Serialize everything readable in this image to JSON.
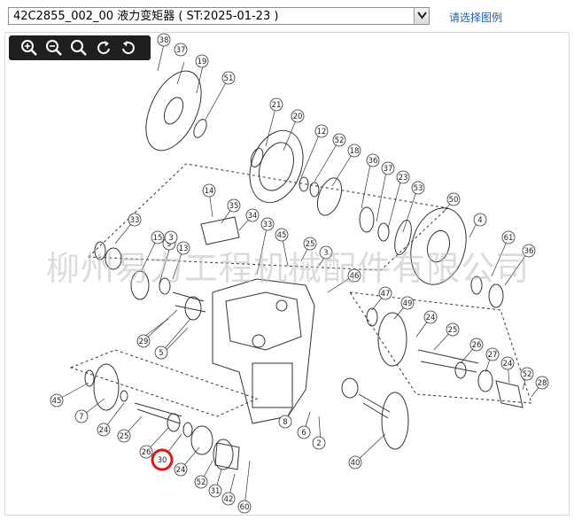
{
  "header": {
    "diagram_select_value": "42C2855_002_00 液力变矩器 ( ST:2025-01-23 )",
    "select_diagram_link": "请选择图例"
  },
  "toolbar": {
    "buttons": [
      {
        "name": "zoom-in",
        "icon": "zoom-in-icon"
      },
      {
        "name": "zoom-out",
        "icon": "zoom-out-icon"
      },
      {
        "name": "zoom-fit",
        "icon": "zoom-fit-icon"
      },
      {
        "name": "rotate-right",
        "icon": "rotate-right-icon"
      },
      {
        "name": "rotate-left",
        "icon": "rotate-left-icon"
      }
    ]
  },
  "watermark": "柳州易力工程机械配件有限公司",
  "callouts": {
    "selected": "30",
    "labels": [
      "38",
      "37",
      "19",
      "51",
      "21",
      "20",
      "12",
      "52",
      "18",
      "36",
      "37",
      "23",
      "53",
      "50",
      "14",
      "35",
      "34",
      "33",
      "45",
      "15",
      "33",
      "9",
      "13",
      "3",
      "25",
      "3",
      "46",
      "47",
      "49",
      "24",
      "25",
      "26",
      "27",
      "24",
      "52",
      "28",
      "29",
      "5",
      "2",
      "8",
      "6",
      "40",
      "45",
      "7",
      "24",
      "25",
      "26",
      "30",
      "24",
      "52",
      "31",
      "42",
      "60",
      "4",
      "61",
      "36",
      "9",
      "13"
    ]
  },
  "colors": {
    "selected_ring": "#e01616",
    "toolbar_bg": "#1f1f1f",
    "link": "#1b5fb0",
    "drawing_stroke": "#333333"
  }
}
